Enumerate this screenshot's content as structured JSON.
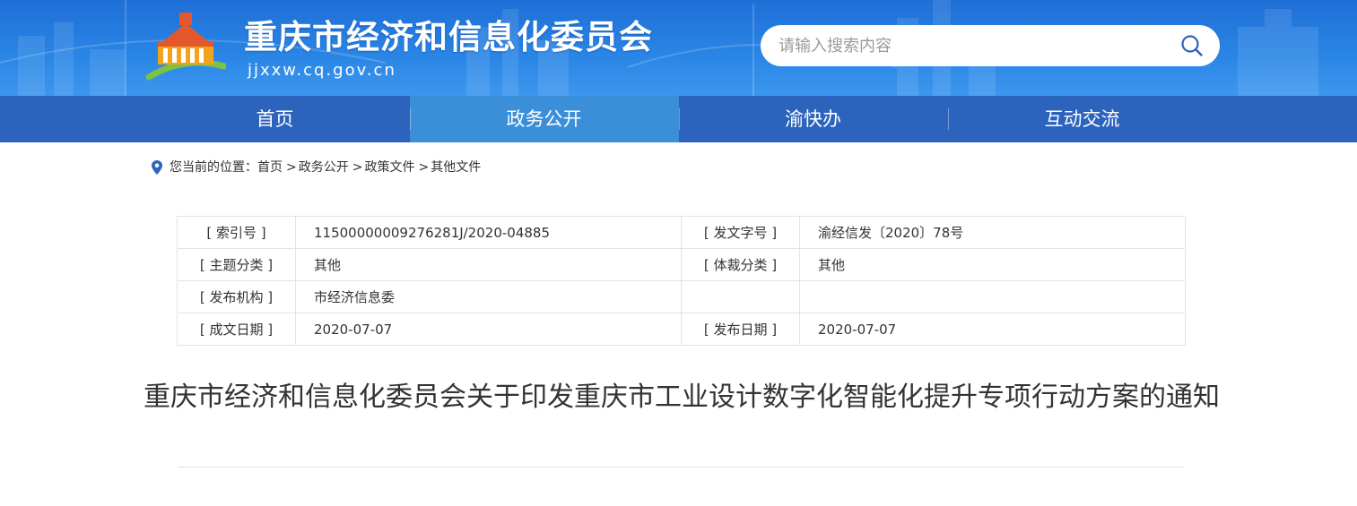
{
  "header": {
    "site_title": "重庆市经济和信息化委员会",
    "site_url": "jjxxw.cq.gov.cn",
    "search": {
      "placeholder": "请输入搜索内容",
      "icon": "search-icon"
    }
  },
  "nav": {
    "items": [
      {
        "label": "首页"
      },
      {
        "label": "政务公开",
        "active": true
      },
      {
        "label": "渝快办"
      },
      {
        "label": "互动交流"
      }
    ]
  },
  "breadcrumb": {
    "prefix": "您当前的位置：",
    "items": [
      "首页",
      "政务公开",
      "政策文件",
      "其他文件"
    ],
    "separator": ">"
  },
  "meta": {
    "rows": [
      [
        "[ 索引号 ]",
        "11500000009276281J/2020-04885",
        "[ 发文字号 ]",
        "渝经信发〔2020〕78号"
      ],
      [
        "[ 主题分类 ]",
        "其他",
        "[ 体裁分类 ]",
        "其他"
      ],
      [
        "[ 发布机构 ]",
        "市经济信息委",
        "",
        ""
      ],
      [
        "[ 成文日期 ]",
        "2020-07-07",
        "[ 发布日期 ]",
        "2020-07-07"
      ]
    ]
  },
  "document": {
    "title": "重庆市经济和信息化委员会关于印发重庆市工业设计数字化智能化提升专项行动方案的通知"
  },
  "colors": {
    "header_blue": "#2a86e6",
    "nav_blue": "#2c63bd",
    "nav_active": "#3b8ed8",
    "pin_blue": "#2c63bd"
  }
}
